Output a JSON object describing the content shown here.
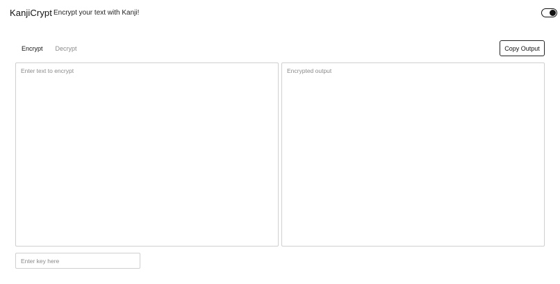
{
  "header": {
    "brand": "KanjiCrypt",
    "tagline": "Encrypt your text with Kanji!",
    "theme_toggle": {
      "state": "on",
      "icon": "toggle-switch"
    }
  },
  "tabs": [
    {
      "label": "Encrypt",
      "active": true
    },
    {
      "label": "Decrypt",
      "active": false
    }
  ],
  "toolbar": {
    "copy_label": "Copy Output"
  },
  "editor": {
    "input_value": "",
    "input_placeholder": "Enter text to encrypt",
    "output_value": "",
    "output_placeholder": "Encrypted output"
  },
  "key": {
    "value": "",
    "placeholder": "Enter key here"
  },
  "colors": {
    "text": "#111111",
    "muted": "#8a8a8a",
    "border": "#cfcfcf",
    "background": "#ffffff"
  }
}
